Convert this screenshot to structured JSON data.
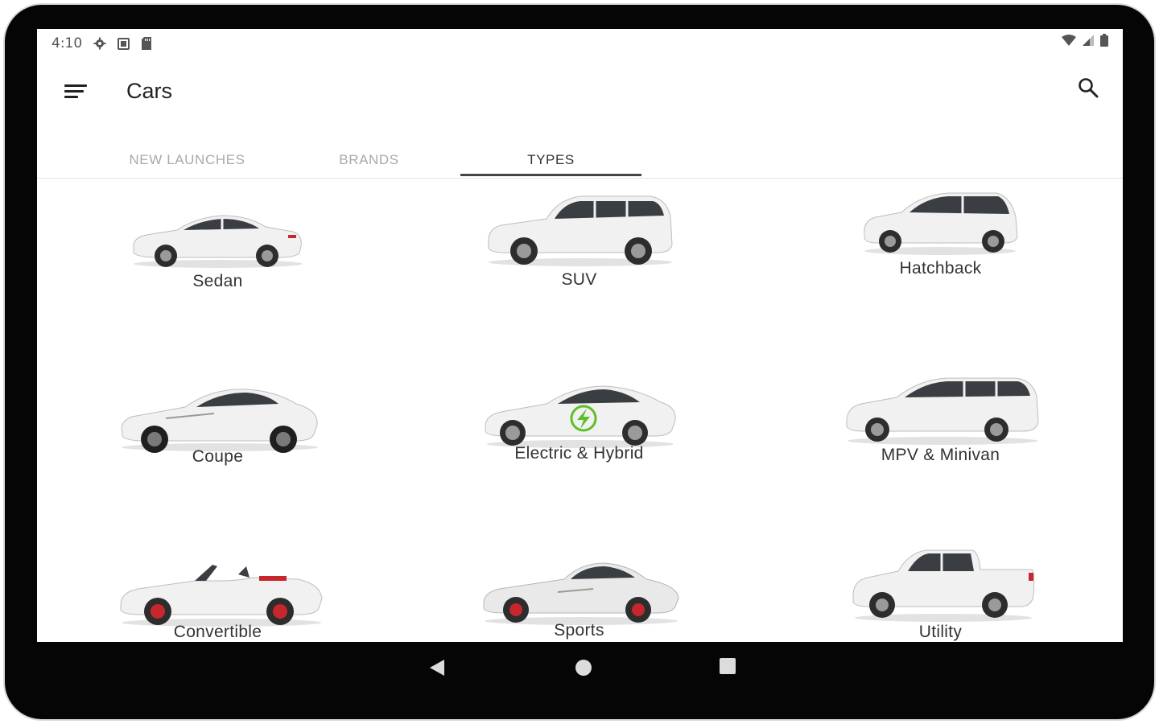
{
  "status_bar": {
    "time": "4:10",
    "left_icons": [
      "gear-icon",
      "screenshot-icon",
      "sd-card-icon"
    ],
    "right_icons": [
      "wifi-icon",
      "signal-icon",
      "battery-icon"
    ]
  },
  "app_bar": {
    "title": "Cars",
    "menu_icon": "menu-icon",
    "search_icon": "search-icon"
  },
  "tabs": [
    {
      "label": "NEW LAUNCHES",
      "active": false
    },
    {
      "label": "BRANDS",
      "active": false
    },
    {
      "label": "TYPES",
      "active": true
    }
  ],
  "car_types": [
    {
      "label": "Sedan",
      "body": "sedan"
    },
    {
      "label": "SUV",
      "body": "suv"
    },
    {
      "label": "Hatchback",
      "body": "hatchback"
    },
    {
      "label": "Coupe",
      "body": "coupe"
    },
    {
      "label": "Electric & Hybrid",
      "body": "electric"
    },
    {
      "label": "MPV & Minivan",
      "body": "minivan"
    },
    {
      "label": "Convertible",
      "body": "convertible"
    },
    {
      "label": "Sports",
      "body": "sports"
    },
    {
      "label": "Utility",
      "body": "pickup"
    }
  ],
  "colors": {
    "accent": "#444444",
    "tab_inactive": "#a9a9a9",
    "electric_badge": "#5fbf2a",
    "car_body": "#f1f1f1",
    "brake_accent": "#c8262d"
  },
  "nav_bar": {
    "back_icon": "back-triangle-icon",
    "home_icon": "home-circle-icon",
    "recents_icon": "recents-square-icon"
  }
}
